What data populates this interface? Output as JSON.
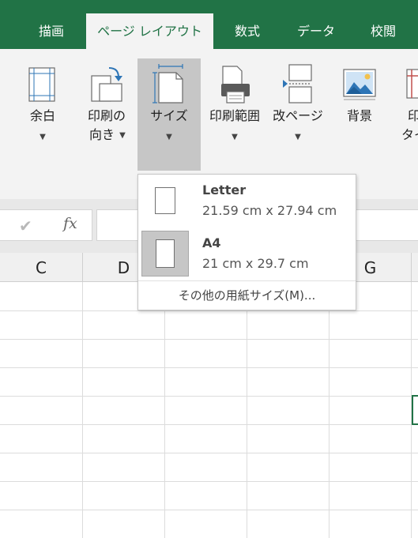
{
  "tabs": [
    {
      "label": "描画",
      "active": false
    },
    {
      "label": "ページ レイアウト",
      "active": true
    },
    {
      "label": "数式",
      "active": false
    },
    {
      "label": "データ",
      "active": false
    },
    {
      "label": "校閲",
      "active": false
    }
  ],
  "ribbon": {
    "margins": {
      "line1": "余白",
      "icon": "margins-icon"
    },
    "orientation": {
      "line1": "印刷の",
      "line2": "向き",
      "icon": "orientation-icon"
    },
    "size": {
      "line1": "サイズ",
      "icon": "size-icon",
      "selected": true
    },
    "print_area": {
      "line1": "印刷範囲",
      "icon": "print-area-icon"
    },
    "breaks": {
      "line1": "改ページ",
      "icon": "page-break-icon"
    },
    "background": {
      "line1": "背景",
      "icon": "background-image-icon"
    },
    "print_titles": {
      "line1": "印",
      "line2": "タイ",
      "icon": "print-titles-icon"
    }
  },
  "formula_bar": {
    "enter_symbol": "✔",
    "fx_label": "fx",
    "value": ""
  },
  "columns": [
    "C",
    "D",
    "G"
  ],
  "size_menu": {
    "items": [
      {
        "name": "Letter",
        "size": "21.59 cm x 27.94 cm",
        "selected": false
      },
      {
        "name": "A4",
        "size": "21 cm x 29.7 cm",
        "selected": true
      }
    ],
    "more_label": "その他の用紙サイズ(M)..."
  },
  "colors": {
    "accent": "#217346",
    "ribbon_bg": "#f3f3f3",
    "selected_bg": "#c6c6c6"
  }
}
